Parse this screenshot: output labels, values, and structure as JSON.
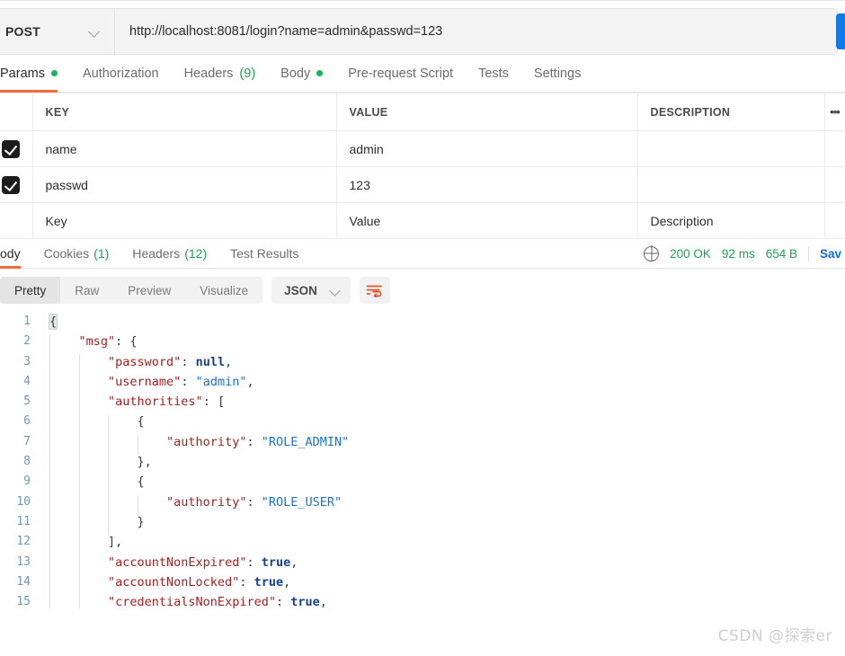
{
  "request": {
    "method": "POST",
    "url": "http://localhost:8081/login?name=admin&passwd=123",
    "send_label": "",
    "tabs": [
      {
        "label": "Params",
        "dot": true,
        "count": "",
        "active": true
      },
      {
        "label": "Authorization",
        "dot": false,
        "count": "",
        "active": false
      },
      {
        "label": "Headers",
        "dot": false,
        "count": "(9)",
        "active": false
      },
      {
        "label": "Body",
        "dot": true,
        "count": "",
        "active": false
      },
      {
        "label": "Pre-request Script",
        "dot": false,
        "count": "",
        "active": false
      },
      {
        "label": "Tests",
        "dot": false,
        "count": "",
        "active": false
      },
      {
        "label": "Settings",
        "dot": false,
        "count": "",
        "active": false
      }
    ]
  },
  "params_table": {
    "headers": {
      "key": "KEY",
      "value": "VALUE",
      "description": "DESCRIPTION",
      "options": "•••"
    },
    "rows": [
      {
        "checked": true,
        "key": "name",
        "value": "admin",
        "description": ""
      },
      {
        "checked": true,
        "key": "passwd",
        "value": "123",
        "description": ""
      }
    ],
    "new_row": {
      "key": "Key",
      "value": "Value",
      "description": "Description"
    }
  },
  "response": {
    "tabs": [
      {
        "label": "ody",
        "count": "",
        "active": true
      },
      {
        "label": "Cookies",
        "count": "(1)",
        "active": false
      },
      {
        "label": "Headers",
        "count": "(12)",
        "active": false
      },
      {
        "label": "Test Results",
        "count": "",
        "active": false
      }
    ],
    "status": "200 OK",
    "time": "92 ms",
    "size": "654 B",
    "save_label": "Sav",
    "format_tabs": [
      {
        "label": "Pretty",
        "active": true
      },
      {
        "label": "Raw",
        "active": false
      },
      {
        "label": "Preview",
        "active": false
      },
      {
        "label": "Visualize",
        "active": false
      }
    ],
    "language": "JSON"
  },
  "body_lines": [
    {
      "n": "1",
      "segs": [
        {
          "t": "{",
          "c": "p brk-hl"
        }
      ],
      "indent": 0
    },
    {
      "n": "2",
      "segs": [
        {
          "t": "    \"msg\"",
          "c": "k"
        },
        {
          "t": ": {",
          "c": "p"
        }
      ],
      "indent": 1
    },
    {
      "n": "3",
      "segs": [
        {
          "t": "        \"password\"",
          "c": "k"
        },
        {
          "t": ": ",
          "c": "p"
        },
        {
          "t": "null",
          "c": "b"
        },
        {
          "t": ",",
          "c": "p"
        }
      ],
      "indent": 2
    },
    {
      "n": "4",
      "segs": [
        {
          "t": "        \"username\"",
          "c": "k"
        },
        {
          "t": ": ",
          "c": "p"
        },
        {
          "t": "\"admin\"",
          "c": "s"
        },
        {
          "t": ",",
          "c": "p"
        }
      ],
      "indent": 2
    },
    {
      "n": "5",
      "segs": [
        {
          "t": "        \"authorities\"",
          "c": "k"
        },
        {
          "t": ": [",
          "c": "p"
        }
      ],
      "indent": 2
    },
    {
      "n": "6",
      "segs": [
        {
          "t": "            {",
          "c": "p"
        }
      ],
      "indent": 3
    },
    {
      "n": "7",
      "segs": [
        {
          "t": "                \"authority\"",
          "c": "k"
        },
        {
          "t": ": ",
          "c": "p"
        },
        {
          "t": "\"ROLE_ADMIN\"",
          "c": "s"
        }
      ],
      "indent": 4
    },
    {
      "n": "8",
      "segs": [
        {
          "t": "            },",
          "c": "p"
        }
      ],
      "indent": 3
    },
    {
      "n": "9",
      "segs": [
        {
          "t": "            {",
          "c": "p"
        }
      ],
      "indent": 3
    },
    {
      "n": "10",
      "segs": [
        {
          "t": "                \"authority\"",
          "c": "k"
        },
        {
          "t": ": ",
          "c": "p"
        },
        {
          "t": "\"ROLE_USER\"",
          "c": "s"
        }
      ],
      "indent": 4
    },
    {
      "n": "11",
      "segs": [
        {
          "t": "            }",
          "c": "p"
        }
      ],
      "indent": 3
    },
    {
      "n": "12",
      "segs": [
        {
          "t": "        ],",
          "c": "p"
        }
      ],
      "indent": 2
    },
    {
      "n": "13",
      "segs": [
        {
          "t": "        \"accountNonExpired\"",
          "c": "k"
        },
        {
          "t": ": ",
          "c": "p"
        },
        {
          "t": "true",
          "c": "b"
        },
        {
          "t": ",",
          "c": "p"
        }
      ],
      "indent": 2
    },
    {
      "n": "14",
      "segs": [
        {
          "t": "        \"accountNonLocked\"",
          "c": "k"
        },
        {
          "t": ": ",
          "c": "p"
        },
        {
          "t": "true",
          "c": "b"
        },
        {
          "t": ",",
          "c": "p"
        }
      ],
      "indent": 2
    },
    {
      "n": "15",
      "segs": [
        {
          "t": "        \"credentialsNonExpired\"",
          "c": "k"
        },
        {
          "t": ": ",
          "c": "p"
        },
        {
          "t": "true",
          "c": "b"
        },
        {
          "t": ",",
          "c": "p"
        }
      ],
      "indent": 2
    }
  ],
  "watermark": "CSDN @探索er",
  "colors": {
    "accent_orange": "#f26b3a",
    "send_blue": "#0d7ce8",
    "status_green": "#1f9e54",
    "json_key": "#a31f1f",
    "json_string": "#1a73d2",
    "json_literal": "#14418f"
  }
}
